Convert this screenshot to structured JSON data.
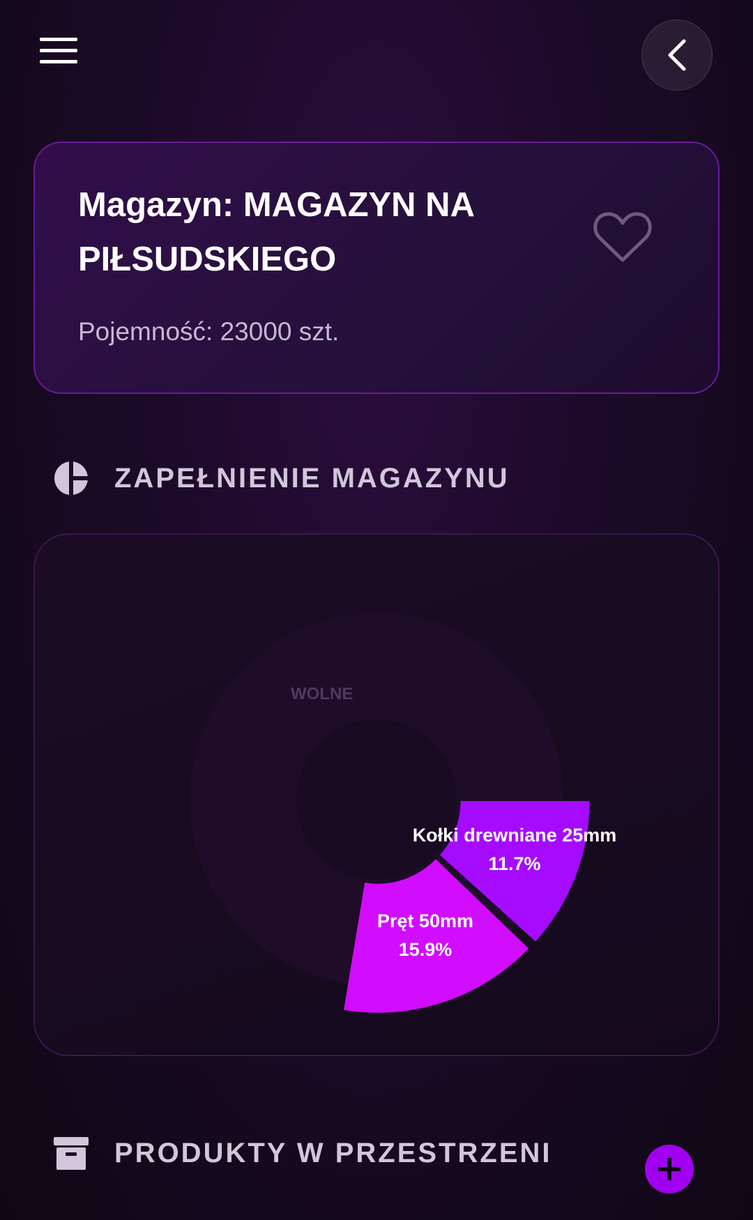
{
  "header": {
    "menu_icon": "hamburger-menu-icon",
    "back_icon": "chevron-left-icon"
  },
  "warehouse": {
    "title": "Magazyn: MAGAZYN NA PIŁSUDSKIEGO",
    "capacity": "Pojemność: 23000 szt.",
    "favorite_icon": "heart-outline-icon"
  },
  "fill_section": {
    "title": "ZAPEŁNIENIE MAGAZYNU",
    "icon": "pie-chart-icon"
  },
  "products_section": {
    "title": "PRODUKTY W PRZESTRZENI",
    "icon": "archive-box-icon",
    "add_icon": "plus-icon"
  },
  "colors": {
    "accent": "#a100f0",
    "slice_kolki": "#a50bff",
    "slice_pret": "#d10cff",
    "slice_wolne": "#261131"
  },
  "chart_data": {
    "type": "pie",
    "variant": "donut",
    "slices": [
      {
        "label": "Kołki drewniane 25mm",
        "value": 11.7,
        "value_label": "11.7%",
        "color": "#a50bff"
      },
      {
        "label": "Pręt 50mm",
        "value": 15.9,
        "value_label": "15.9%",
        "color": "#d10cff"
      },
      {
        "label": "WOLNE",
        "value": 72.4,
        "value_label": "",
        "color": "#261131"
      }
    ]
  }
}
